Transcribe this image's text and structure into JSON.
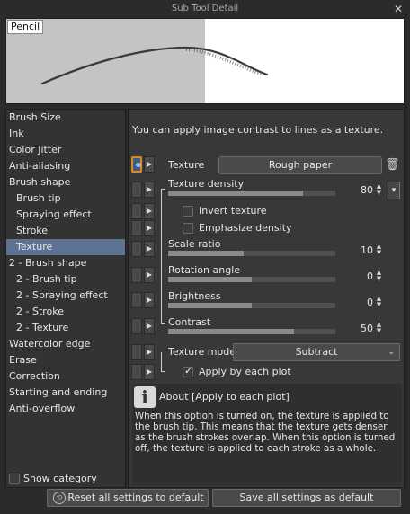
{
  "window": {
    "title": "Sub Tool Detail"
  },
  "preview": {
    "tool_name": "Pencil"
  },
  "categories": [
    {
      "label": "Brush Size"
    },
    {
      "label": "Ink"
    },
    {
      "label": "Color Jitter"
    },
    {
      "label": "Anti-aliasing"
    },
    {
      "label": "Brush shape"
    },
    {
      "label": "Brush tip"
    },
    {
      "label": "Spraying effect"
    },
    {
      "label": "Stroke"
    },
    {
      "label": "Texture"
    },
    {
      "label": "2 - Brush shape"
    },
    {
      "label": "2 - Brush tip"
    },
    {
      "label": "2 - Spraying effect"
    },
    {
      "label": "2 - Stroke"
    },
    {
      "label": "2 - Texture"
    },
    {
      "label": "Watercolor edge"
    },
    {
      "label": "Erase"
    },
    {
      "label": "Correction"
    },
    {
      "label": "Starting and ending"
    },
    {
      "label": "Anti-overflow"
    }
  ],
  "show_category_label": "Show category",
  "panel": {
    "description": "You can apply image contrast to lines as a texture.",
    "texture_label": "Texture",
    "texture_value": "Rough paper",
    "texture_density": {
      "label": "Texture density",
      "value": "80",
      "level": 0.8
    },
    "invert_texture": "Invert texture",
    "emphasize_density": "Emphasize density",
    "scale_ratio": {
      "label": "Scale ratio",
      "value": "10",
      "level": 0.45
    },
    "rotation_angle": {
      "label": "Rotation angle",
      "value": "0",
      "level": 0.5
    },
    "brightness": {
      "label": "Brightness",
      "value": "0",
      "level": 0.5
    },
    "contrast": {
      "label": "Contrast",
      "value": "50",
      "level": 0.75
    },
    "texture_mode_label": "Texture mode",
    "texture_mode_value": "Subtract",
    "apply_each_plot": "Apply by each plot"
  },
  "about": {
    "title": "About [Apply to each plot]",
    "body": "When this option is turned on, the texture is applied to the brush tip. This means that the texture gets denser as the brush strokes overlap. When this option is turned off, the texture is applied to each stroke as a whole."
  },
  "footer": {
    "reset_label": "Reset all settings to default",
    "save_label": "Save all settings as default"
  }
}
